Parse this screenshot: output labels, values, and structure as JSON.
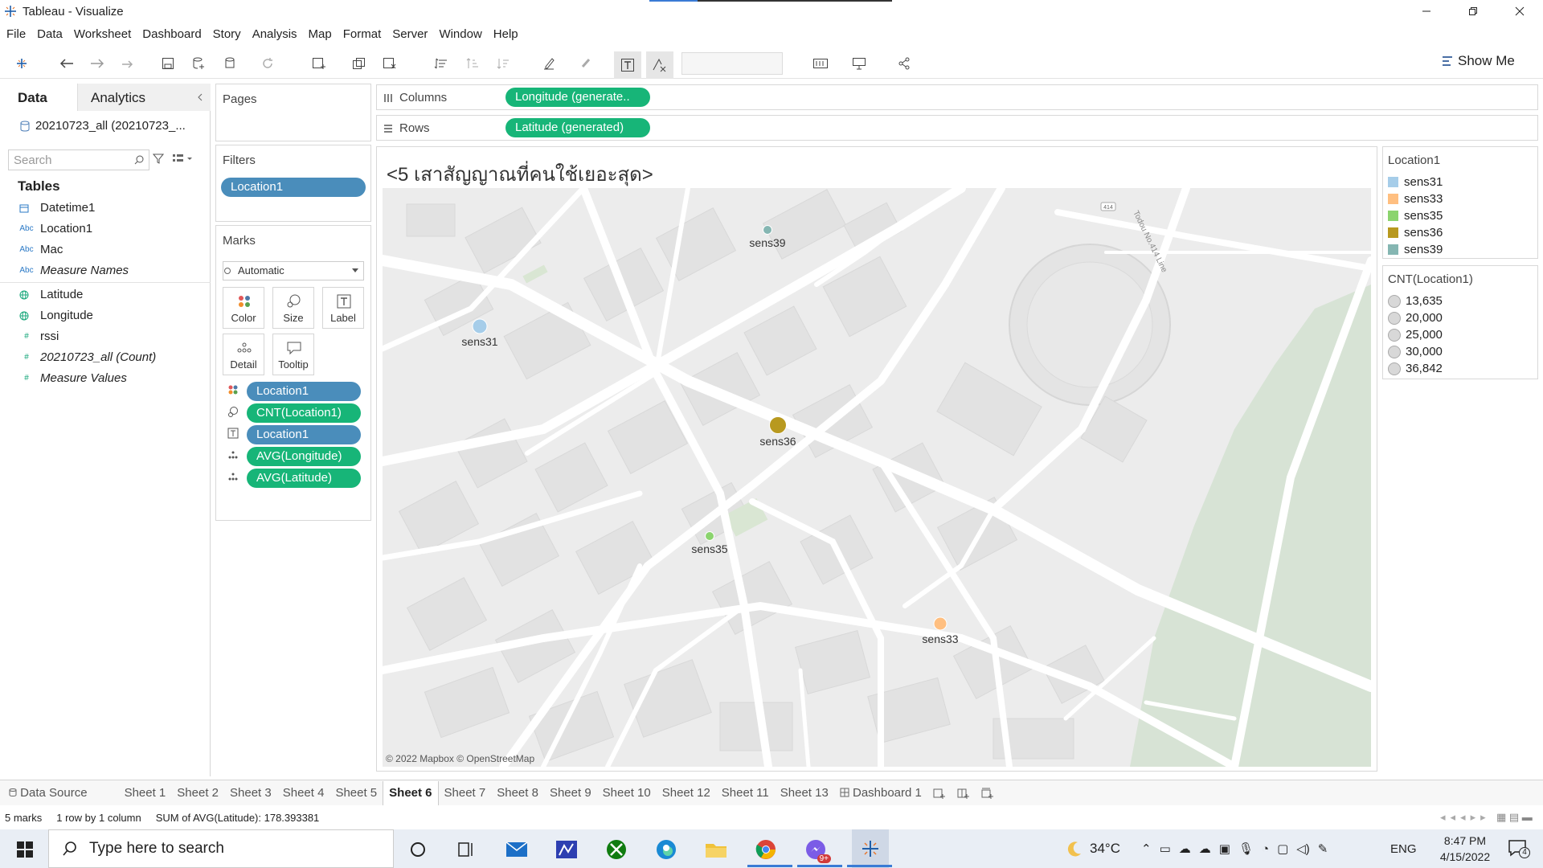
{
  "window": {
    "title": "Tableau - Visualize"
  },
  "menu": [
    "File",
    "Data",
    "Worksheet",
    "Dashboard",
    "Story",
    "Analysis",
    "Map",
    "Format",
    "Server",
    "Window",
    "Help"
  ],
  "toolbar": {
    "show_me": "Show Me"
  },
  "left_pane": {
    "tab_data": "Data",
    "tab_analytics": "Analytics",
    "datasource": "20210723_all (20210723_...",
    "search_placeholder": "Search",
    "tables_heading": "Tables",
    "fields": [
      {
        "type": "date",
        "name": "Datetime1"
      },
      {
        "type": "abc",
        "name": "Location1"
      },
      {
        "type": "abc",
        "name": "Mac"
      },
      {
        "type": "abc",
        "name": "Measure Names"
      },
      {
        "type": "geo",
        "name": "Latitude"
      },
      {
        "type": "geo",
        "name": "Longitude"
      },
      {
        "type": "num",
        "name": "rssi"
      },
      {
        "type": "num",
        "name": "20210723_all (Count)"
      },
      {
        "type": "num",
        "name": "Measure Values"
      }
    ],
    "abc_tag": "Abc",
    "num_tag": "#"
  },
  "pages": {
    "header": "Pages"
  },
  "filters": {
    "header": "Filters",
    "pill": "Location1"
  },
  "marks": {
    "header": "Marks",
    "type": "Automatic",
    "buttons": [
      "Color",
      "Size",
      "Label",
      "Detail",
      "Tooltip"
    ],
    "pills": [
      "Location1",
      "CNT(Location1)",
      "Location1",
      "AVG(Longitude)",
      "AVG(Latitude)"
    ]
  },
  "shelves": {
    "columns_label": "Columns",
    "columns_pill": "Longitude (generate..",
    "rows_label": "Rows",
    "rows_pill": "Latitude (generated)"
  },
  "viz": {
    "title": "<5 เสาสัญญาณที่คนใช้เยอะสุด>",
    "attribution": "© 2022 Mapbox © OpenStreetMap",
    "road_label_1": "414",
    "road_label_2": "Todou No.414 Line",
    "points": [
      {
        "name": "sens31",
        "color": "#a6cde9"
      },
      {
        "name": "sens39",
        "color": "#85b6b2"
      },
      {
        "name": "sens36",
        "color": "#b8991f"
      },
      {
        "name": "sens35",
        "color": "#8bd46e"
      },
      {
        "name": "sens33",
        "color": "#ffbf80"
      }
    ]
  },
  "legend_color": {
    "title": "Location1",
    "items": [
      {
        "label": "sens31",
        "color": "#a6cde9"
      },
      {
        "label": "sens33",
        "color": "#ffbf80"
      },
      {
        "label": "sens35",
        "color": "#8bd46e"
      },
      {
        "label": "sens36",
        "color": "#b8991f"
      },
      {
        "label": "sens39",
        "color": "#85b6b2"
      }
    ]
  },
  "legend_size": {
    "title": "CNT(Location1)",
    "items": [
      "13,635",
      "20,000",
      "25,000",
      "30,000",
      "36,842"
    ]
  },
  "sheet_tabs": {
    "data_source": "Data Source",
    "sheets": [
      "Sheet 1",
      "Sheet 2",
      "Sheet 3",
      "Sheet 4",
      "Sheet 5",
      "Sheet 6",
      "Sheet 7",
      "Sheet 8",
      "Sheet 9",
      "Sheet 10",
      "Sheet 12",
      "Sheet 11",
      "Sheet 13"
    ],
    "active": "Sheet 6",
    "dashboard": "Dashboard 1"
  },
  "status": {
    "marks": "5 marks",
    "dims": "1 row by 1 column",
    "sum": "SUM of AVG(Latitude): 178.393381"
  },
  "taskbar": {
    "search_placeholder": "Type here to search",
    "weather": "34°C",
    "lang": "ENG",
    "time": "8:47 PM",
    "date": "4/15/2022",
    "notif_count": "4",
    "badge": "9+"
  }
}
